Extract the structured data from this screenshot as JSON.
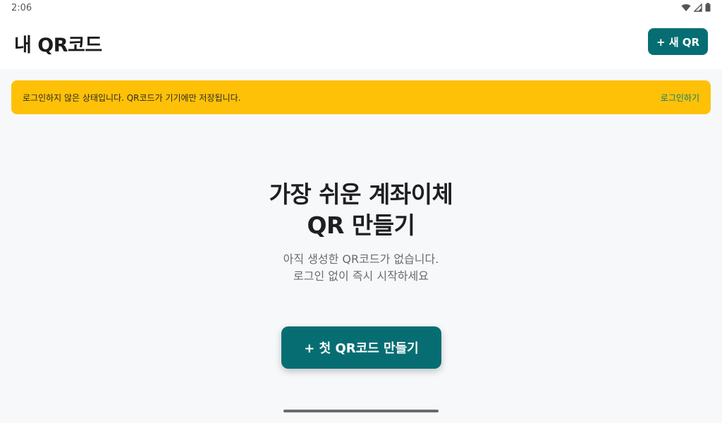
{
  "status_bar": {
    "time": "2:06",
    "icons": [
      "wifi-icon",
      "cellular-signal-icon",
      "battery-icon"
    ]
  },
  "app_bar": {
    "title": "내 QR코드",
    "new_qr_button": "+ 새 QR"
  },
  "banner": {
    "message": "로그인하지 않은 상태입니다. QR코드가 기기에만 저장됩니다.",
    "login_link": "로그인하기"
  },
  "empty_state": {
    "title_line1": "가장 쉬운 계좌이체",
    "title_line2": "QR 만들기",
    "subtitle_line1": "아직 생성한 QR코드가 없습니다.",
    "subtitle_line2": "로그인 없이 즉시 시작하세요",
    "cta_button": "+ 첫 QR코드 만들기"
  },
  "colors": {
    "primary": "#066e72",
    "banner_bg": "#fec107",
    "link": "#0b7d83",
    "background": "#f7f8fa"
  }
}
